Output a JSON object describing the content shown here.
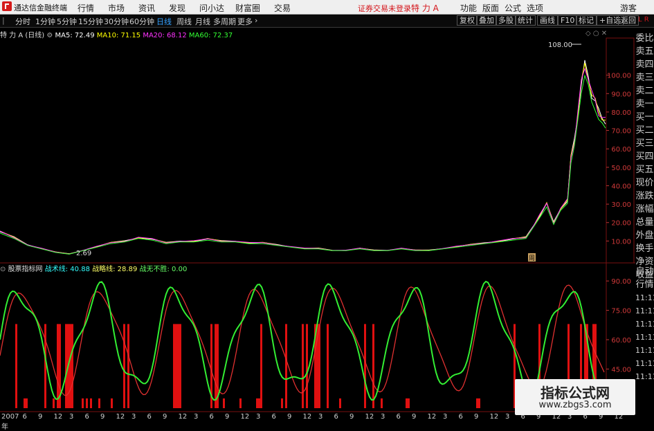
{
  "app": {
    "title": "通达信金融终端",
    "login_status": "证券交易未登录",
    "stock_title": "特 力 A",
    "guest": "游客"
  },
  "menu": [
    "行情",
    "市场",
    "资讯",
    "发现",
    "问小达",
    "财富圈",
    "交易"
  ],
  "right_menu": [
    "功能",
    "版面",
    "公式",
    "选项"
  ],
  "toolbar": {
    "periods": [
      "分时",
      "1分钟",
      "5分钟",
      "15分钟",
      "30分钟",
      "60分钟",
      "日线",
      "周线",
      "月线",
      "多周期",
      "更多"
    ],
    "active": "日线",
    "buttons": [
      "复权",
      "叠加",
      "多股",
      "统计",
      "画线",
      "F10",
      "标记",
      "+自选",
      "返回"
    ],
    "corner": "L R"
  },
  "main_legend": {
    "name": "特 力 A",
    "period": "(日线)",
    "ma5": "MA5: 72.49",
    "ma10": "MA10: 71.15",
    "ma20": "MA20: 68.12",
    "ma60": "MA60: 72.37",
    "colors": {
      "ma5": "#ffffff",
      "ma10": "#ffff00",
      "ma20": "#ff33ff",
      "ma60": "#33ff33"
    }
  },
  "price_axis": [
    "100.00",
    "90.00",
    "80.00",
    "70.00",
    "60.00",
    "50.00",
    "40.00",
    "30.00",
    "20.00",
    "10.00"
  ],
  "annotations": {
    "high": "108.00",
    "low": "2.69",
    "mark": "周"
  },
  "right_list": [
    "委比",
    "卖五",
    "卖四",
    "卖三",
    "卖二",
    "卖一",
    "买一",
    "买二",
    "买三",
    "买四",
    "买五",
    "现价",
    "涨跌",
    "涨幅",
    "总量",
    "外盘",
    "换手",
    "净资",
    "收益"
  ],
  "right_list2": [
    "自动",
    "行情",
    "11:11",
    "11:11",
    "11:11",
    "11:11",
    "11:11",
    "11:11",
    "11:11"
  ],
  "indicator": {
    "name": "股票指标网",
    "l1": "战术线: 40.88",
    "l2": "战略线: 28.89",
    "l3": "战无不胜: 0.00",
    "colors": {
      "l1": "#33ffff",
      "l2": "#ffff66",
      "l3": "#66ff66"
    }
  },
  "ind_axis": [
    "90.00",
    "75.00",
    "60.00",
    "45.00",
    "30.00"
  ],
  "dates": [
    "2007年",
    "6",
    "9",
    "12",
    "3",
    "6",
    "9",
    "12",
    "3",
    "6",
    "9",
    "12",
    "3",
    "6",
    "9",
    "12",
    "3",
    "6",
    "9",
    "12",
    "3",
    "6",
    "9",
    "12",
    "3",
    "6",
    "9",
    "12",
    "3",
    "6",
    "9",
    "12",
    "3",
    "6",
    "9",
    "12",
    "3",
    "6",
    "9",
    "12"
  ],
  "watermark": {
    "title": "指标公式网",
    "url": "www.zbgs3.com"
  },
  "chart_data": {
    "type": "line",
    "title": "",
    "price": {
      "x": [
        0,
        20,
        40,
        60,
        80,
        100,
        120,
        140,
        160,
        180,
        200,
        220,
        240,
        260,
        280,
        300,
        320,
        340,
        360,
        380,
        400,
        420,
        440,
        460,
        480,
        500,
        520,
        540,
        560,
        580,
        600,
        620,
        640,
        660,
        680,
        700,
        720,
        740,
        760,
        770,
        780,
        790,
        800,
        810,
        820,
        825,
        830,
        835,
        840,
        845,
        850,
        855,
        860,
        865,
        870,
        875
      ],
      "y": [
        15,
        12,
        8,
        6,
        4,
        3,
        5,
        7,
        9,
        10,
        12,
        11,
        9,
        10,
        10,
        11,
        10,
        10,
        9,
        9,
        8,
        7,
        6,
        6,
        5,
        5,
        6,
        5,
        5,
        6,
        5,
        5,
        6,
        7,
        8,
        9,
        10,
        11,
        12,
        18,
        24,
        30,
        20,
        28,
        32,
        55,
        65,
        80,
        95,
        105,
        100,
        90,
        85,
        80,
        78,
        75
      ]
    },
    "ylim": [
      0,
      110
    ],
    "indicator": {
      "ylim": [
        25,
        95
      ]
    }
  }
}
